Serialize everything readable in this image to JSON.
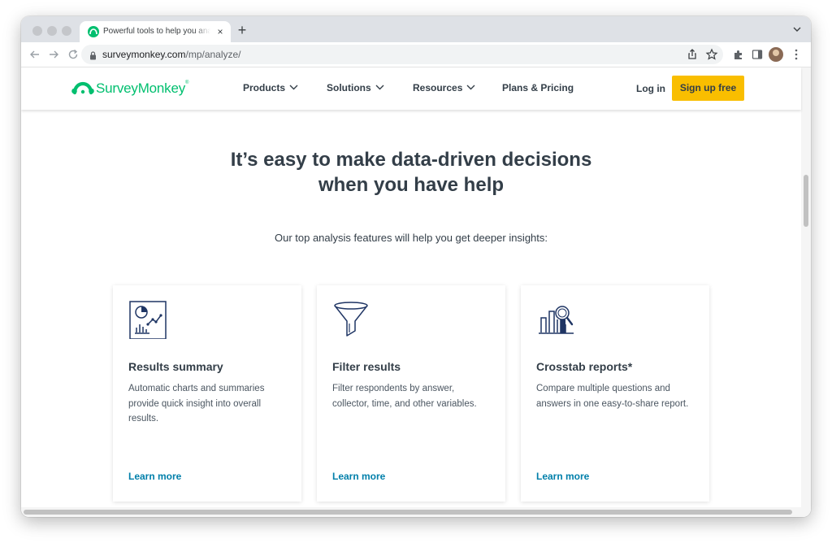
{
  "browser": {
    "tab_title": "Powerful tools to help you analyze survey results",
    "tab_close": "×",
    "new_tab": "+",
    "url_host": "surveymonkey.com",
    "url_path": "/mp/analyze/"
  },
  "site": {
    "logo_text": "SurveyMonkey",
    "logo_tm": "®",
    "nav": {
      "products": "Products",
      "solutions": "Solutions",
      "resources": "Resources",
      "pricing": "Plans & Pricing"
    },
    "login": "Log in",
    "signup": "Sign up free"
  },
  "hero": {
    "headline_line1": "It’s easy to make data-driven decisions",
    "headline_line2": "when you have help",
    "subhead": "Our top analysis features will help you get deeper insights:"
  },
  "cards": [
    {
      "icon": "chart-summary-icon",
      "title": "Results summary",
      "description": "Automatic charts and summaries provide quick insight into overall results.",
      "link": "Learn more"
    },
    {
      "icon": "funnel-icon",
      "title": "Filter results",
      "description": "Filter respondents by answer, collector, time, and other variables.",
      "link": "Learn more"
    },
    {
      "icon": "crosstab-icon",
      "title": "Crosstab reports*",
      "description": "Compare multiple questions and answers in one easy-to-share report.",
      "link": "Learn more"
    }
  ],
  "colors": {
    "brand_green": "#00bf6f",
    "signup_yellow": "#f9be00",
    "link_blue": "#007faa",
    "icon_navy": "#1f3564",
    "text_dark": "#333e48"
  }
}
